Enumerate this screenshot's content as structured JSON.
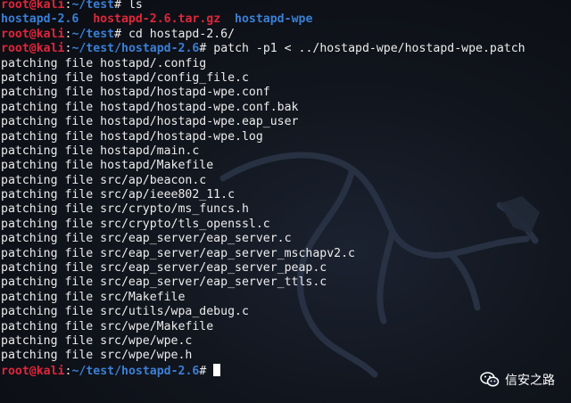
{
  "prompt": {
    "user": "root",
    "at": "@",
    "host": "kali",
    "colon": ":"
  },
  "lines": [
    {
      "type": "prompt",
      "path": "~/test",
      "symbol": "#",
      "command": " ls"
    },
    {
      "type": "listing",
      "items": [
        {
          "name": "hostapd-2.6",
          "kind": "dir"
        },
        {
          "name": "hostapd-2.6.tar.gz",
          "kind": "archive"
        },
        {
          "name": "hostapd-wpe",
          "kind": "dir"
        }
      ]
    },
    {
      "type": "prompt",
      "path": "~/test",
      "symbol": "#",
      "command": " cd hostapd-2.6/"
    },
    {
      "type": "prompt",
      "path": "~/test/hostapd-2.6",
      "symbol": "#",
      "command": " patch -p1 < ../hostapd-wpe/hostapd-wpe.patch"
    },
    {
      "type": "output",
      "text": "patching file hostapd/.config"
    },
    {
      "type": "output",
      "text": "patching file hostapd/config_file.c"
    },
    {
      "type": "output",
      "text": "patching file hostapd/hostapd-wpe.conf"
    },
    {
      "type": "output",
      "text": "patching file hostapd/hostapd-wpe.conf.bak"
    },
    {
      "type": "output",
      "text": "patching file hostapd/hostapd-wpe.eap_user"
    },
    {
      "type": "output",
      "text": "patching file hostapd/hostapd-wpe.log"
    },
    {
      "type": "output",
      "text": "patching file hostapd/main.c"
    },
    {
      "type": "output",
      "text": "patching file hostapd/Makefile"
    },
    {
      "type": "output",
      "text": "patching file src/ap/beacon.c"
    },
    {
      "type": "output",
      "text": "patching file src/ap/ieee802_11.c"
    },
    {
      "type": "output",
      "text": "patching file src/crypto/ms_funcs.h"
    },
    {
      "type": "output",
      "text": "patching file src/crypto/tls_openssl.c"
    },
    {
      "type": "output",
      "text": "patching file src/eap_server/eap_server.c"
    },
    {
      "type": "output",
      "text": "patching file src/eap_server/eap_server_mschapv2.c"
    },
    {
      "type": "output",
      "text": "patching file src/eap_server/eap_server_peap.c"
    },
    {
      "type": "output",
      "text": "patching file src/eap_server/eap_server_ttls.c"
    },
    {
      "type": "output",
      "text": "patching file src/Makefile"
    },
    {
      "type": "output",
      "text": "patching file src/utils/wpa_debug.c"
    },
    {
      "type": "output",
      "text": "patching file src/wpe/Makefile"
    },
    {
      "type": "output",
      "text": "patching file src/wpe/wpe.c"
    },
    {
      "type": "output",
      "text": "patching file src/wpe/wpe.h"
    },
    {
      "type": "prompt",
      "path": "~/test/hostapd-2.6",
      "symbol": "#",
      "command": " ",
      "cursor": true
    }
  ],
  "watermark": {
    "icon": "wechat-icon",
    "text": "信安之路"
  },
  "colors": {
    "user": "#e0263a",
    "path": "#3b7fd6",
    "text": "#ececec",
    "background": "#11151d"
  }
}
